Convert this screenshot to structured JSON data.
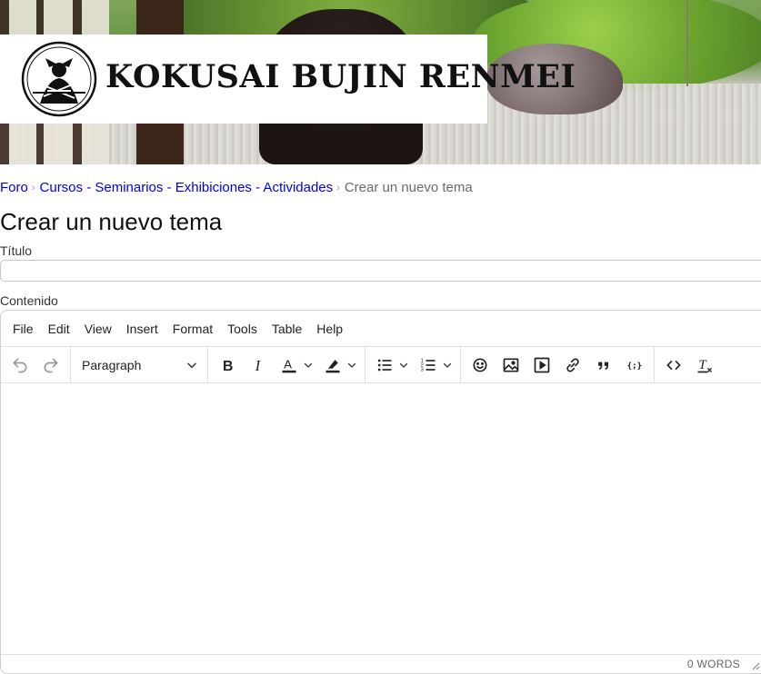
{
  "banner": {
    "logo_text": "KOKUSAI BUJIN RENMEI"
  },
  "breadcrumb": {
    "items": [
      "Foro",
      "Cursos - Seminarios - Exhibiciones - Actividades"
    ],
    "current": "Crear un nuevo tema"
  },
  "page_title": "Crear un nuevo tema",
  "form": {
    "title_label": "Título",
    "title_value": "",
    "content_label": "Contenido"
  },
  "editor": {
    "menu": [
      "File",
      "Edit",
      "View",
      "Insert",
      "Format",
      "Tools",
      "Table",
      "Help"
    ],
    "block_format": "Paragraph",
    "word_count": "0 WORDS"
  },
  "colors": {
    "link": "#0000ee",
    "text": "#222222",
    "border": "#cfcfcf"
  }
}
